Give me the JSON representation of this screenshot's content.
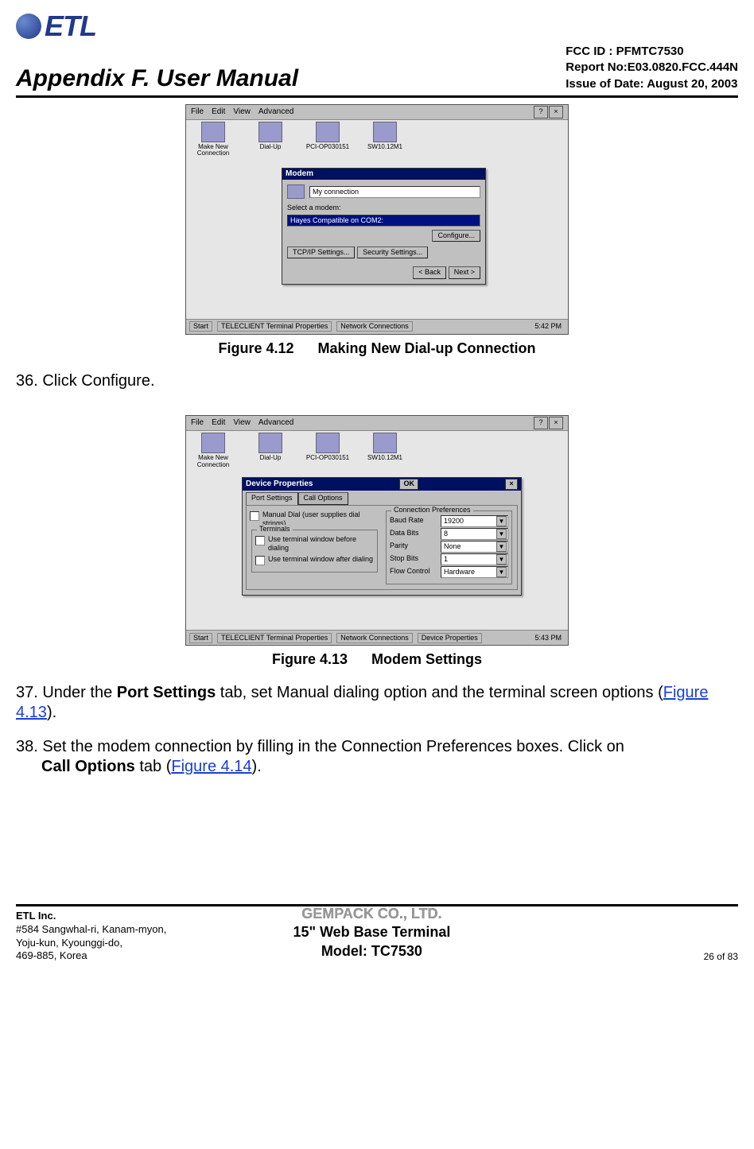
{
  "header": {
    "logo_text": "ETL",
    "title": "Appendix F. User Manual",
    "fcc": "FCC ID : PFMTC7530",
    "report": "Report No:E03.0820.FCC.444N",
    "issue": "Issue of Date:  August 20, 2003"
  },
  "fig412": {
    "caption_no": "Figure 4.12",
    "caption_txt": "Making New Dial-up Connection",
    "menu": {
      "file": "File",
      "edit": "Edit",
      "view": "View",
      "advanced": "Advanced"
    },
    "icons": {
      "i1": "Make New Connection",
      "i2": "Dial-Up",
      "i3": "PCI-OP030151",
      "i4": "SW10.12M1"
    },
    "modal": {
      "title": "Modem",
      "conn_name_lbl": "My connection",
      "select_lbl": "Select a modem:",
      "modem_sel": "Hayes Compatible on COM2:",
      "btn_configure": "Configure...",
      "btn_tcpip": "TCP/IP Settings...",
      "btn_security": "Security Settings...",
      "btn_back": "< Back",
      "btn_next": "Next >"
    },
    "taskbar": {
      "start": "Start",
      "t1": "TELECLIENT Terminal Properties",
      "t2": "Network Connections",
      "clock": "5:42 PM"
    }
  },
  "step36": "36. Click Configure.",
  "fig413": {
    "caption_no": "Figure 4.13",
    "caption_txt": "Modem Settings",
    "menu": {
      "file": "File",
      "edit": "Edit",
      "view": "View",
      "advanced": "Advanced"
    },
    "icons": {
      "i1": "Make New Connection",
      "i2": "Dial-Up",
      "i3": "PCI-OP030151",
      "i4": "SW10.12M1"
    },
    "modal": {
      "title": "Device Properties",
      "ok": "OK",
      "tab_port": "Port Settings",
      "tab_call": "Call Options",
      "manual_dial": "Manual Dial (user supplies dial strings)",
      "terminals_legend": "Terminals",
      "chk_before": "Use terminal window before dialing",
      "chk_after": "Use terminal window after dialing",
      "prefs_legend": "Connection Preferences",
      "baud_lbl": "Baud Rate",
      "baud_val": "19200",
      "data_lbl": "Data Bits",
      "data_val": "8",
      "parity_lbl": "Parity",
      "parity_val": "None",
      "stop_lbl": "Stop Bits",
      "stop_val": "1",
      "flow_lbl": "Flow Control",
      "flow_val": "Hardware"
    },
    "taskbar": {
      "start": "Start",
      "t1": "TELECLIENT Terminal Properties",
      "t2": "Network Connections",
      "t3": "Device Properties",
      "clock": "5:43 PM"
    }
  },
  "step37": {
    "pre": "37. Under the ",
    "bold": "Port Settings",
    "mid": " tab, set Manual dialing option and the terminal screen options (",
    "link": "Figure 4.13",
    "post": ")."
  },
  "step38": {
    "pre": "38. Set the modem connection by filling in the Connection Preferences boxes. Click on ",
    "bold": "Call Options",
    "mid": " tab (",
    "link": "Figure 4.14",
    "post": ")."
  },
  "footer": {
    "company": "ETL Inc.",
    "addr1": "#584 Sangwhal-ri, Kanam-myon,",
    "addr2": "Yoju-kun, Kyounggi-do,",
    "addr3": "469-885, Korea",
    "c1": "GEMPACK CO., LTD.",
    "c2": "15\" Web Base Terminal",
    "c3": "Model: TC7530",
    "page": "26 of 83"
  }
}
